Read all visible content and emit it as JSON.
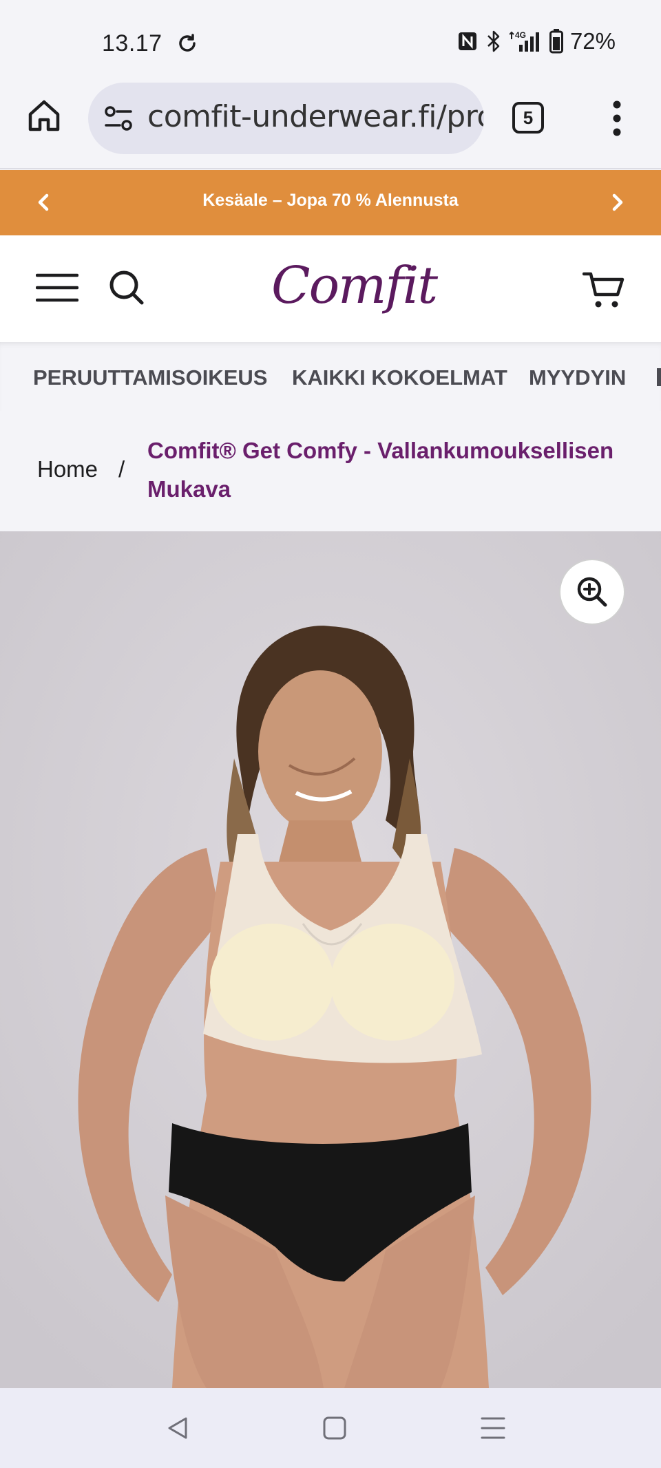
{
  "status_bar": {
    "time": "13.17",
    "battery": "72%",
    "network": "4G"
  },
  "browser": {
    "url": "comfit-underwear.fi/prod",
    "tab_count": "5"
  },
  "promo": {
    "text": "Kesäale – Jopa 70 % Alennusta"
  },
  "header": {
    "logo_text": "Comfit"
  },
  "nav": {
    "items": [
      {
        "label": "PERUUTTAMISOIKEUS"
      },
      {
        "label": "KAIKKI KOKOELMAT"
      },
      {
        "label": "MYYDYIN"
      }
    ]
  },
  "breadcrumb": {
    "home": "Home",
    "separator": "/",
    "current": "Comfit® Get Comfy - Vallankumouksellisen Mukava"
  },
  "colors": {
    "promo_bg": "#e08e3d",
    "brand_purple": "#5b1a5e",
    "breadcrumb_accent": "#6a1f6c"
  },
  "icons": {
    "home": "home-icon",
    "search": "search-icon",
    "menu": "hamburger-menu-icon",
    "cart": "cart-icon",
    "zoom": "zoom-in-icon"
  }
}
